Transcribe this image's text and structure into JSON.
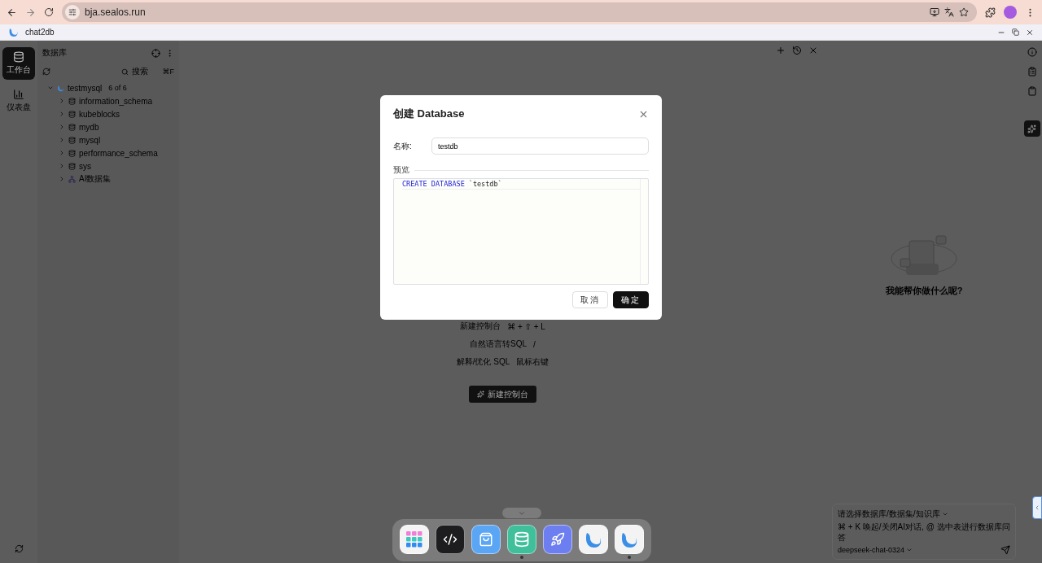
{
  "browser": {
    "url": "bja.sealos.run",
    "tab_title": "chat2db"
  },
  "rail": {
    "items": [
      {
        "label": "工作台",
        "kind": "database",
        "selected": true
      },
      {
        "label": "仪表盘",
        "kind": "chart",
        "selected": false
      }
    ]
  },
  "sidebar": {
    "title": "数据库",
    "search_placeholder": "搜索",
    "search_shortcut": "⌘F",
    "tree": [
      {
        "label": "testmysql",
        "count": "6 of 6",
        "expanded": true,
        "children": [
          {
            "label": "information_schema",
            "kind": "database",
            "expanded": false
          },
          {
            "label": "kubeblocks",
            "kind": "database",
            "expanded": false
          },
          {
            "label": "mydb",
            "kind": "database",
            "expanded": false
          },
          {
            "label": "mysql",
            "kind": "database",
            "expanded": false
          },
          {
            "label": "performance_schema",
            "kind": "database",
            "expanded": false
          },
          {
            "label": "sys",
            "kind": "database",
            "expanded": false
          },
          {
            "label": "AI数据集",
            "kind": "dataset",
            "expanded": false
          }
        ]
      }
    ]
  },
  "main": {
    "shortcuts": [
      {
        "label": "新建控制台",
        "keys": "⌘ + ⇧ + L"
      },
      {
        "label": "自然语言转SQL",
        "keys": "/"
      },
      {
        "label": "解释/优化 SQL",
        "keys": "鼠标右键"
      }
    ],
    "new_console_button": "新建控制台"
  },
  "ai_panel": {
    "title": "我能帮你做什么呢?",
    "source_placeholder": "请选择数据库/数据集/知识库",
    "input_placeholder": "⌘ + K 唤起/关闭AI对话, @ 选中表进行数据库问答",
    "model": "deepseek-chat-0324"
  },
  "dialog": {
    "title": "创建 Database",
    "name_label": "名称:",
    "name_value": "testdb",
    "preview_label": "预览",
    "sql": [
      {
        "text": "CREATE DATABASE",
        "kind": "keyword"
      },
      {
        "text": "`testdb`",
        "kind": "identifier"
      }
    ],
    "cancel_button": "取消",
    "ok_button": "确定"
  },
  "dock": {
    "apps": [
      {
        "kind": "launchpad",
        "running": false
      },
      {
        "kind": "code",
        "running": false
      },
      {
        "kind": "store",
        "running": false
      },
      {
        "kind": "database",
        "running": true
      },
      {
        "kind": "rocket",
        "running": false
      },
      {
        "kind": "chat2db",
        "running": false
      },
      {
        "kind": "chat2db",
        "running": true
      }
    ]
  }
}
